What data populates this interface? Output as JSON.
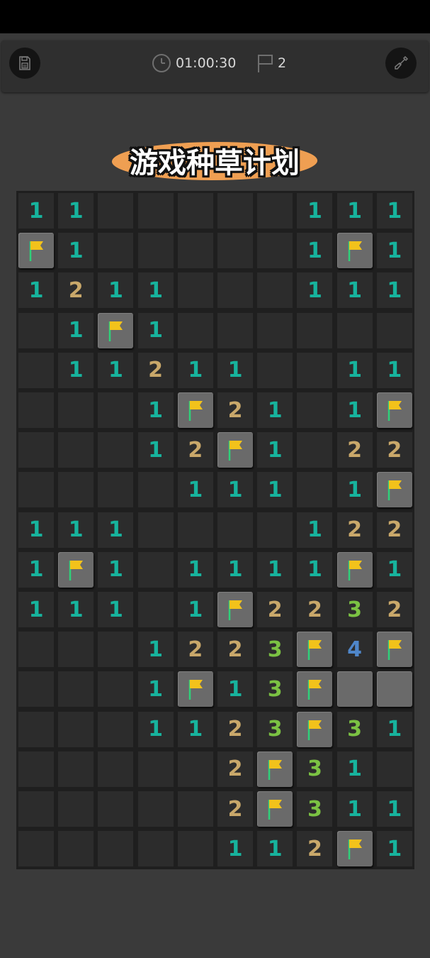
{
  "header": {
    "timer": "01:00:30",
    "flags_count": "2"
  },
  "title": "游戏种草计划",
  "icons": {
    "save": "floppy-disk-icon",
    "timer": "clock-icon",
    "flags": "flag-outline-icon",
    "settings": "shovel-icon"
  },
  "colors": {
    "n1": "#17b39d",
    "n2": "#c9a86a",
    "n3": "#7bc243",
    "n4": "#4f86c9",
    "flag": "#f2c21b",
    "flag_pole": "#2fd07a",
    "title_blob": "#ef9f52"
  },
  "board": {
    "legend": "number = revealed count, E = revealed empty, F = flagged, C = covered",
    "rows": [
      [
        "1",
        "1",
        "E",
        "E",
        "E",
        "E",
        "E",
        "1",
        "1",
        "1"
      ],
      [
        "F",
        "1",
        "E",
        "E",
        "E",
        "E",
        "E",
        "1",
        "F",
        "1"
      ],
      [
        "1",
        "2",
        "1",
        "1",
        "E",
        "E",
        "E",
        "1",
        "1",
        "1"
      ],
      [
        "E",
        "1",
        "F",
        "1",
        "E",
        "E",
        "E",
        "E",
        "E",
        "E"
      ],
      [
        "E",
        "1",
        "1",
        "2",
        "1",
        "1",
        "E",
        "E",
        "1",
        "1"
      ],
      [
        "E",
        "E",
        "E",
        "1",
        "F",
        "2",
        "1",
        "E",
        "1",
        "F"
      ],
      [
        "E",
        "E",
        "E",
        "1",
        "2",
        "F",
        "1",
        "E",
        "2",
        "2"
      ],
      [
        "E",
        "E",
        "E",
        "E",
        "1",
        "1",
        "1",
        "E",
        "1",
        "F"
      ],
      [
        "1",
        "1",
        "1",
        "E",
        "E",
        "E",
        "E",
        "1",
        "2",
        "2"
      ],
      [
        "1",
        "F",
        "1",
        "E",
        "1",
        "1",
        "1",
        "1",
        "F",
        "1"
      ],
      [
        "1",
        "1",
        "1",
        "E",
        "1",
        "F",
        "2",
        "2",
        "3",
        "2"
      ],
      [
        "E",
        "E",
        "E",
        "1",
        "2",
        "2",
        "3",
        "F",
        "4",
        "F"
      ],
      [
        "E",
        "E",
        "E",
        "1",
        "F",
        "1",
        "3",
        "F",
        "C",
        "C"
      ],
      [
        "E",
        "E",
        "E",
        "1",
        "1",
        "2",
        "3",
        "F",
        "3",
        "1"
      ],
      [
        "E",
        "E",
        "E",
        "E",
        "E",
        "2",
        "F",
        "3",
        "1",
        "E"
      ],
      [
        "E",
        "E",
        "E",
        "E",
        "E",
        "2",
        "F",
        "3",
        "1",
        "1"
      ],
      [
        "E",
        "E",
        "E",
        "E",
        "E",
        "1",
        "1",
        "2",
        "F",
        "1"
      ]
    ]
  }
}
